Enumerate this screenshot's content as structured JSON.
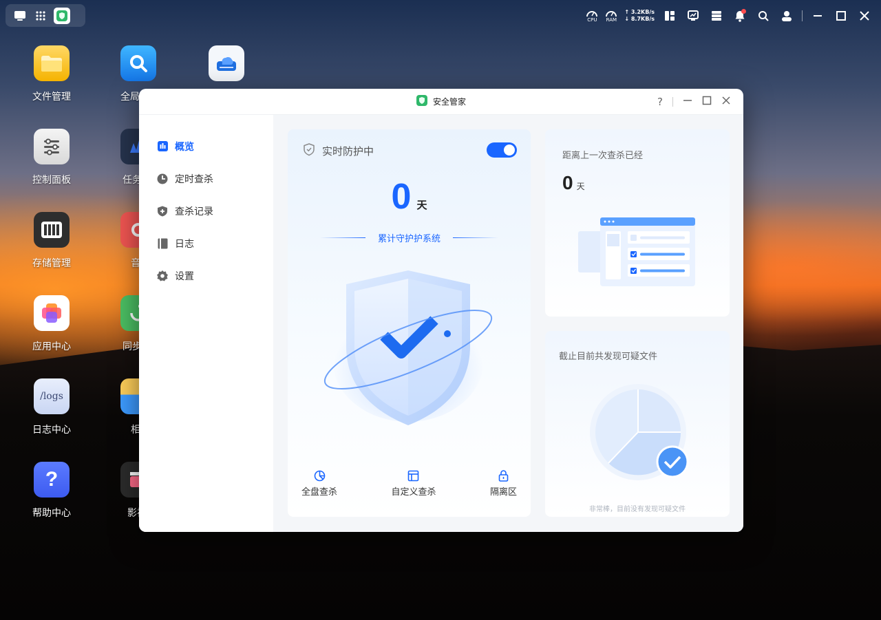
{
  "taskbar": {
    "cpu_label": "CPU",
    "ram_label": "RAM",
    "upload_speed": "↑ 3.2KB/s",
    "download_speed": "↓ 8.7KB/s"
  },
  "desktop": {
    "icons": [
      {
        "label": "文件管理",
        "icon": "folder-icon"
      },
      {
        "label": "全局",
        "icon": "global-search-icon"
      },
      {
        "label": "",
        "icon": "cloud-drive-icon"
      },
      {
        "label": "控制面板",
        "icon": "control-panel-icon"
      },
      {
        "label": "任务管",
        "icon": "task-manager-icon"
      },
      {
        "label": "存储管理",
        "icon": "storage-icon"
      },
      {
        "label": "音",
        "icon": "music-icon"
      },
      {
        "label": "应用中心",
        "icon": "app-center-icon"
      },
      {
        "label": "同步与",
        "icon": "sync-icon"
      },
      {
        "label": "日志中心",
        "icon": "logs-icon",
        "text": "/logs"
      },
      {
        "label": "相",
        "icon": "photos-icon"
      },
      {
        "label": "帮助中心",
        "icon": "help-icon",
        "text": "?"
      },
      {
        "label": "影视",
        "icon": "video-icon"
      }
    ]
  },
  "window": {
    "title": "安全管家",
    "help": "?"
  },
  "sidebar": {
    "items": [
      {
        "label": "概览",
        "icon": "overview-icon",
        "active": true
      },
      {
        "label": "定时查杀",
        "icon": "clock-icon"
      },
      {
        "label": "查杀记录",
        "icon": "shield-plus-icon"
      },
      {
        "label": "日志",
        "icon": "book-icon"
      },
      {
        "label": "设置",
        "icon": "gear-icon"
      }
    ]
  },
  "main_card": {
    "protection_label": "实时防护中",
    "protection_on": true,
    "days_value": "0",
    "days_unit": "天",
    "guard_label": "累计守护护系统",
    "actions": [
      {
        "label": "全盘查杀",
        "icon": "pie-scan-icon"
      },
      {
        "label": "自定义查杀",
        "icon": "custom-scan-icon"
      },
      {
        "label": "隔离区",
        "icon": "lock-icon"
      }
    ]
  },
  "last_scan_card": {
    "title": "距离上一次查杀已经",
    "days_value": "0",
    "days_unit": "天"
  },
  "suspicious_card": {
    "title": "截止目前共发现可疑文件",
    "footer": "非常棒，目前没有发现可疑文件"
  },
  "colors": {
    "accent": "#1a66ff"
  }
}
